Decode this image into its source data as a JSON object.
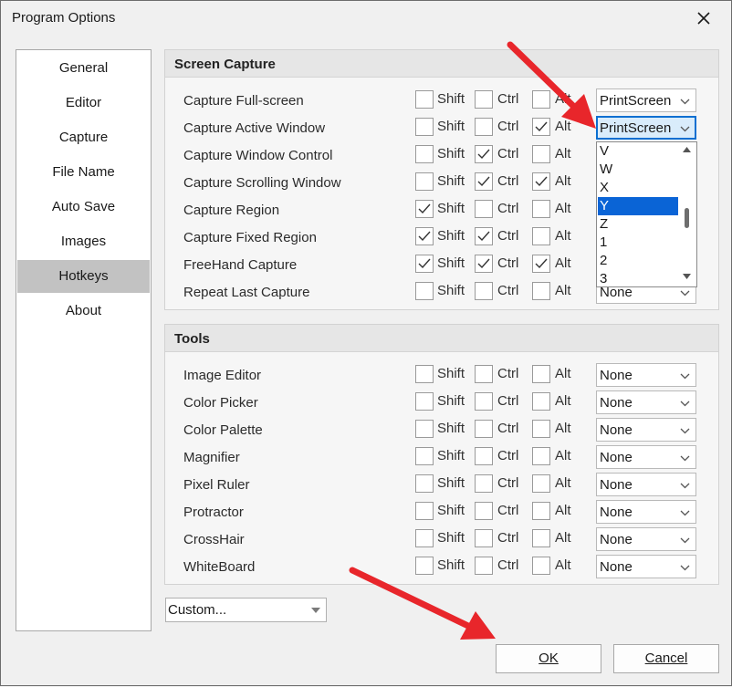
{
  "window": {
    "title": "Program Options"
  },
  "sidebar": {
    "items": [
      {
        "label": "General"
      },
      {
        "label": "Editor"
      },
      {
        "label": "Capture"
      },
      {
        "label": "File Name"
      },
      {
        "label": "Auto Save"
      },
      {
        "label": "Images"
      },
      {
        "label": "Hotkeys",
        "active": true
      },
      {
        "label": "About"
      }
    ]
  },
  "modifiers": {
    "shift": "Shift",
    "ctrl": "Ctrl",
    "alt": "Alt"
  },
  "screen_capture": {
    "title": "Screen Capture",
    "rows": [
      {
        "label": "Capture Full-screen",
        "shift": false,
        "ctrl": false,
        "alt": false,
        "key": "PrintScreen"
      },
      {
        "label": "Capture Active Window",
        "shift": false,
        "ctrl": false,
        "alt": true,
        "key": "PrintScreen"
      },
      {
        "label": "Capture Window Control",
        "shift": false,
        "ctrl": true,
        "alt": false,
        "key": ""
      },
      {
        "label": "Capture Scrolling Window",
        "shift": false,
        "ctrl": true,
        "alt": true,
        "key": ""
      },
      {
        "label": "Capture Region",
        "shift": true,
        "ctrl": false,
        "alt": false,
        "key": ""
      },
      {
        "label": "Capture Fixed Region",
        "shift": true,
        "ctrl": true,
        "alt": false,
        "key": ""
      },
      {
        "label": "FreeHand Capture",
        "shift": true,
        "ctrl": true,
        "alt": true,
        "key": ""
      },
      {
        "label": "Repeat Last Capture",
        "shift": false,
        "ctrl": false,
        "alt": false,
        "key": "None"
      }
    ]
  },
  "tools": {
    "title": "Tools",
    "rows": [
      {
        "label": "Image Editor",
        "shift": false,
        "ctrl": false,
        "alt": false,
        "key": "None"
      },
      {
        "label": "Color Picker",
        "shift": false,
        "ctrl": false,
        "alt": false,
        "key": "None"
      },
      {
        "label": "Color Palette",
        "shift": false,
        "ctrl": false,
        "alt": false,
        "key": "None"
      },
      {
        "label": "Magnifier",
        "shift": false,
        "ctrl": false,
        "alt": false,
        "key": "None"
      },
      {
        "label": "Pixel Ruler",
        "shift": false,
        "ctrl": false,
        "alt": false,
        "key": "None"
      },
      {
        "label": "Protractor",
        "shift": false,
        "ctrl": false,
        "alt": false,
        "key": "None"
      },
      {
        "label": "CrossHair",
        "shift": false,
        "ctrl": false,
        "alt": false,
        "key": "None"
      },
      {
        "label": "WhiteBoard",
        "shift": false,
        "ctrl": false,
        "alt": false,
        "key": "None"
      }
    ]
  },
  "key_dropdown": {
    "options": [
      "V",
      "W",
      "X",
      "Y",
      "Z",
      "1",
      "2",
      "3"
    ],
    "selected": "Y"
  },
  "profile_combo": {
    "value": "Custom..."
  },
  "buttons": {
    "ok": "OK",
    "cancel": "Cancel"
  },
  "colors": {
    "accent": "#0a64d6",
    "annotation_arrow": "#e8262b",
    "active_nav": "#c2c2c2"
  }
}
